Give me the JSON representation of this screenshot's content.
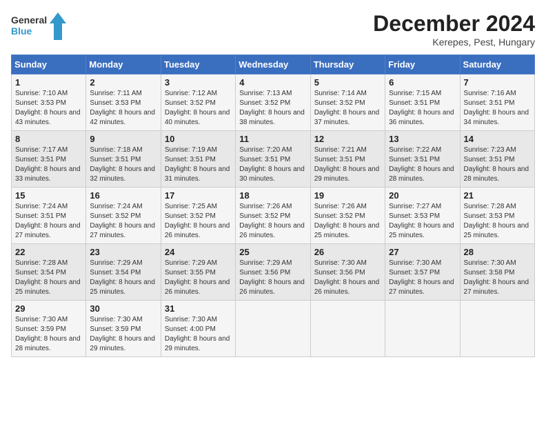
{
  "logo": {
    "line1": "General",
    "line2": "Blue"
  },
  "title": "December 2024",
  "location": "Kerepes, Pest, Hungary",
  "headers": [
    "Sunday",
    "Monday",
    "Tuesday",
    "Wednesday",
    "Thursday",
    "Friday",
    "Saturday"
  ],
  "weeks": [
    [
      {
        "day": "1",
        "sunrise": "7:10 AM",
        "sunset": "3:53 PM",
        "daylight": "8 hours and 43 minutes."
      },
      {
        "day": "2",
        "sunrise": "7:11 AM",
        "sunset": "3:53 PM",
        "daylight": "8 hours and 42 minutes."
      },
      {
        "day": "3",
        "sunrise": "7:12 AM",
        "sunset": "3:52 PM",
        "daylight": "8 hours and 40 minutes."
      },
      {
        "day": "4",
        "sunrise": "7:13 AM",
        "sunset": "3:52 PM",
        "daylight": "8 hours and 38 minutes."
      },
      {
        "day": "5",
        "sunrise": "7:14 AM",
        "sunset": "3:52 PM",
        "daylight": "8 hours and 37 minutes."
      },
      {
        "day": "6",
        "sunrise": "7:15 AM",
        "sunset": "3:51 PM",
        "daylight": "8 hours and 36 minutes."
      },
      {
        "day": "7",
        "sunrise": "7:16 AM",
        "sunset": "3:51 PM",
        "daylight": "8 hours and 34 minutes."
      }
    ],
    [
      {
        "day": "8",
        "sunrise": "7:17 AM",
        "sunset": "3:51 PM",
        "daylight": "8 hours and 33 minutes."
      },
      {
        "day": "9",
        "sunrise": "7:18 AM",
        "sunset": "3:51 PM",
        "daylight": "8 hours and 32 minutes."
      },
      {
        "day": "10",
        "sunrise": "7:19 AM",
        "sunset": "3:51 PM",
        "daylight": "8 hours and 31 minutes."
      },
      {
        "day": "11",
        "sunrise": "7:20 AM",
        "sunset": "3:51 PM",
        "daylight": "8 hours and 30 minutes."
      },
      {
        "day": "12",
        "sunrise": "7:21 AM",
        "sunset": "3:51 PM",
        "daylight": "8 hours and 29 minutes."
      },
      {
        "day": "13",
        "sunrise": "7:22 AM",
        "sunset": "3:51 PM",
        "daylight": "8 hours and 28 minutes."
      },
      {
        "day": "14",
        "sunrise": "7:23 AM",
        "sunset": "3:51 PM",
        "daylight": "8 hours and 28 minutes."
      }
    ],
    [
      {
        "day": "15",
        "sunrise": "7:24 AM",
        "sunset": "3:51 PM",
        "daylight": "8 hours and 27 minutes."
      },
      {
        "day": "16",
        "sunrise": "7:24 AM",
        "sunset": "3:52 PM",
        "daylight": "8 hours and 27 minutes."
      },
      {
        "day": "17",
        "sunrise": "7:25 AM",
        "sunset": "3:52 PM",
        "daylight": "8 hours and 26 minutes."
      },
      {
        "day": "18",
        "sunrise": "7:26 AM",
        "sunset": "3:52 PM",
        "daylight": "8 hours and 26 minutes."
      },
      {
        "day": "19",
        "sunrise": "7:26 AM",
        "sunset": "3:52 PM",
        "daylight": "8 hours and 25 minutes."
      },
      {
        "day": "20",
        "sunrise": "7:27 AM",
        "sunset": "3:53 PM",
        "daylight": "8 hours and 25 minutes."
      },
      {
        "day": "21",
        "sunrise": "7:28 AM",
        "sunset": "3:53 PM",
        "daylight": "8 hours and 25 minutes."
      }
    ],
    [
      {
        "day": "22",
        "sunrise": "7:28 AM",
        "sunset": "3:54 PM",
        "daylight": "8 hours and 25 minutes."
      },
      {
        "day": "23",
        "sunrise": "7:29 AM",
        "sunset": "3:54 PM",
        "daylight": "8 hours and 25 minutes."
      },
      {
        "day": "24",
        "sunrise": "7:29 AM",
        "sunset": "3:55 PM",
        "daylight": "8 hours and 26 minutes."
      },
      {
        "day": "25",
        "sunrise": "7:29 AM",
        "sunset": "3:56 PM",
        "daylight": "8 hours and 26 minutes."
      },
      {
        "day": "26",
        "sunrise": "7:30 AM",
        "sunset": "3:56 PM",
        "daylight": "8 hours and 26 minutes."
      },
      {
        "day": "27",
        "sunrise": "7:30 AM",
        "sunset": "3:57 PM",
        "daylight": "8 hours and 27 minutes."
      },
      {
        "day": "28",
        "sunrise": "7:30 AM",
        "sunset": "3:58 PM",
        "daylight": "8 hours and 27 minutes."
      }
    ],
    [
      {
        "day": "29",
        "sunrise": "7:30 AM",
        "sunset": "3:59 PM",
        "daylight": "8 hours and 28 minutes."
      },
      {
        "day": "30",
        "sunrise": "7:30 AM",
        "sunset": "3:59 PM",
        "daylight": "8 hours and 29 minutes."
      },
      {
        "day": "31",
        "sunrise": "7:30 AM",
        "sunset": "4:00 PM",
        "daylight": "8 hours and 29 minutes."
      },
      null,
      null,
      null,
      null
    ]
  ],
  "labels": {
    "sunrise": "Sunrise:",
    "sunset": "Sunset:",
    "daylight": "Daylight:"
  },
  "accent_color": "#3a6ebf"
}
